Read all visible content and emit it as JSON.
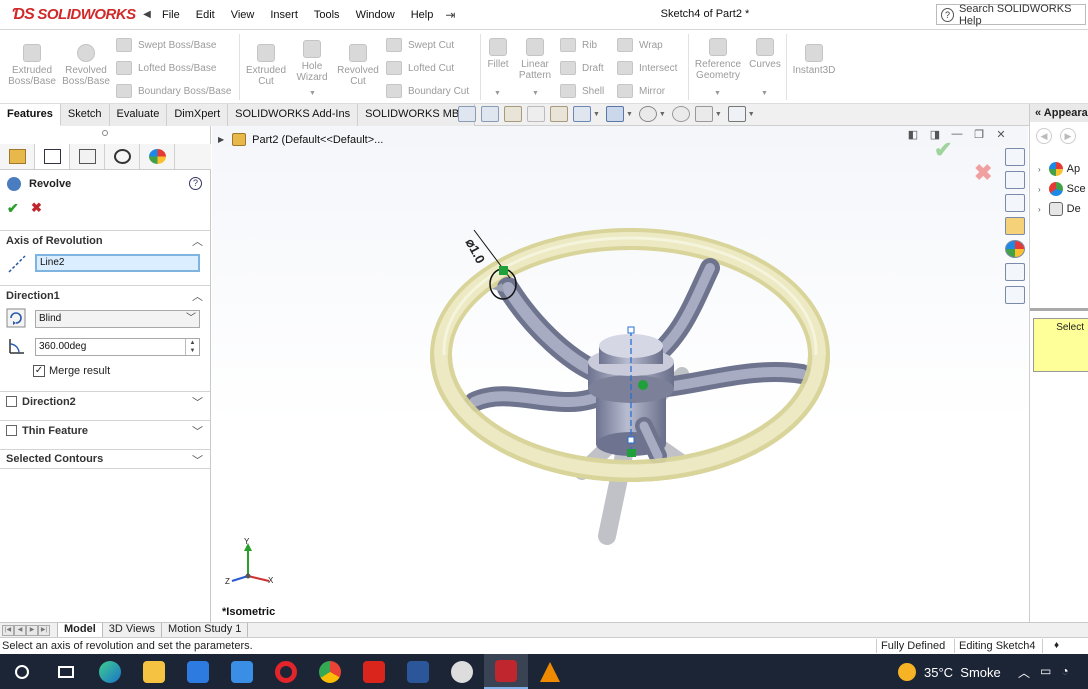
{
  "app": {
    "logo_text": "SOLIDWORKS",
    "menu": [
      "File",
      "Edit",
      "View",
      "Insert",
      "Tools",
      "Window",
      "Help"
    ],
    "document_title": "Sketch4 of Part2 *",
    "search_placeholder": "Search SOLIDWORKS Help"
  },
  "command_manager": {
    "extruded_boss": "Extruded Boss/Base",
    "revolved_boss": "Revolved Boss/Base",
    "swept_boss": "Swept Boss/Base",
    "lofted_boss": "Lofted Boss/Base",
    "boundary_boss": "Boundary Boss/Base",
    "extruded_cut": "Extruded Cut",
    "hole_wizard": "Hole Wizard",
    "revolved_cut": "Revolved Cut",
    "swept_cut": "Swept Cut",
    "lofted_cut": "Lofted Cut",
    "boundary_cut": "Boundary Cut",
    "fillet": "Fillet",
    "linear_pattern": "Linear Pattern",
    "rib": "Rib",
    "draft": "Draft",
    "shell": "Shell",
    "wrap": "Wrap",
    "intersect": "Intersect",
    "mirror": "Mirror",
    "reference_geometry": "Reference Geometry",
    "curves": "Curves",
    "instant3d": "Instant3D"
  },
  "tabs": [
    "Features",
    "Sketch",
    "Evaluate",
    "DimXpert",
    "SOLIDWORKS Add-Ins",
    "SOLIDWORKS MBD"
  ],
  "property_manager": {
    "title": "Revolve",
    "axis_header": "Axis of Revolution",
    "axis_value": "Line2",
    "direction1_header": "Direction1",
    "end_condition": "Blind",
    "angle": "360.00deg",
    "merge_result": "Merge result",
    "direction2_header": "Direction2",
    "thin_feature_header": "Thin Feature",
    "selected_contours_header": "Selected Contours"
  },
  "graphics": {
    "tree_label": "Part2  (Default<<Default>...",
    "view_orientation": "*Isometric",
    "dimension_label": "⌀1.0",
    "triad_y": "Y",
    "triad_x": "X",
    "triad_z": "Z"
  },
  "task_pane": {
    "header": "Appearances",
    "items": [
      "Ap",
      "Sce",
      "De"
    ],
    "select_note": "Select"
  },
  "bottom_tabs": [
    "Model",
    "3D Views",
    "Motion Study 1"
  ],
  "status": {
    "message": "Select an axis of revolution and set the parameters.",
    "defined": "Fully Defined",
    "editing": "Editing Sketch4"
  },
  "taskbar": {
    "temperature": "35°C",
    "weather": "Smoke"
  },
  "colors": {
    "brand_red": "#d02a2a",
    "ring": "#e6e3b4",
    "spoke": "#8a8fa8",
    "selection": "#dbeeff"
  }
}
